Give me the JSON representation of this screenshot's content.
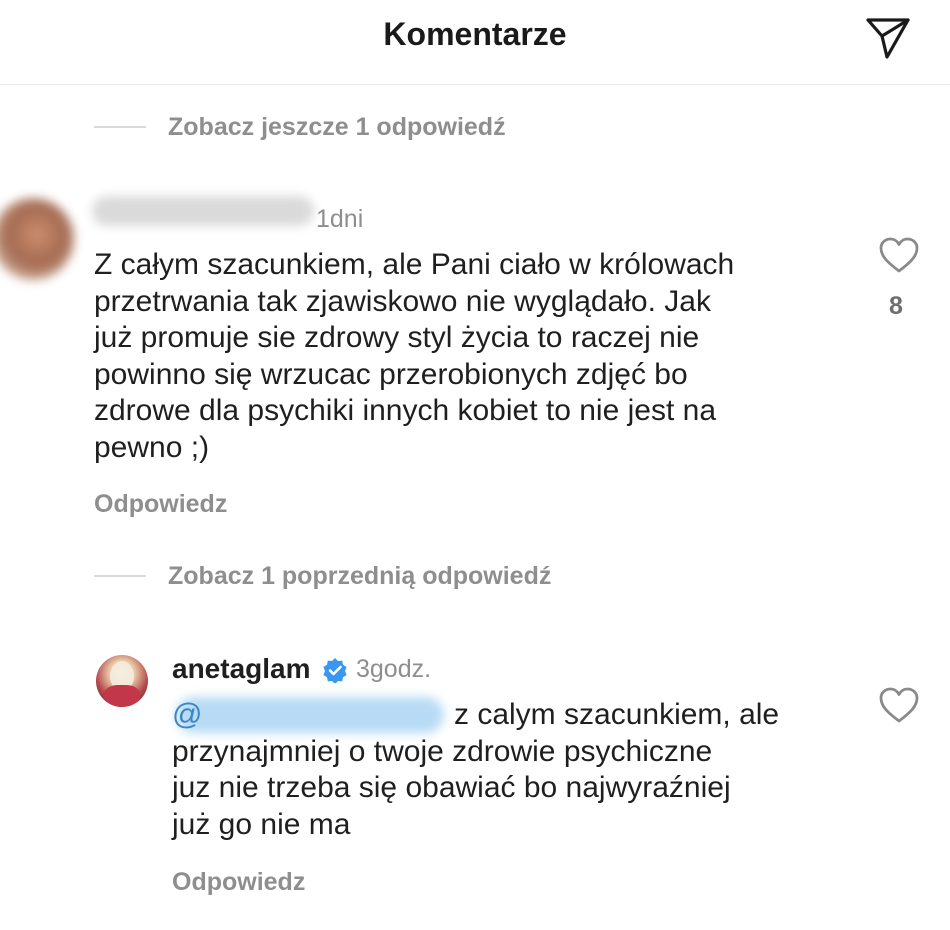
{
  "header": {
    "title": "Komentarze",
    "send_icon": "paper-plane-icon"
  },
  "threads": {
    "view_more_top": "Zobacz jeszcze 1 odpowiedź",
    "view_previous": "Zobacz 1 poprzednią odpowiedź"
  },
  "comment1": {
    "time": "1dni",
    "text_lines": [
      "Z całym szacunkiem, ale Pani ciało w królowach",
      "przetrwania tak zjawiskowo nie wyglądało. Jak",
      "już promuje sie zdrowy styl życia to raczej nie",
      "powinno się wrzucac przerobionych zdjęć bo",
      "zdrowe dla psychiki innych kobiet to nie jest na",
      "pewno ;)"
    ],
    "reply_label": "Odpowiedz",
    "like_count": "8"
  },
  "comment2": {
    "username": "anetaglam",
    "time": "3godz.",
    "mention_prefix": "@",
    "text_first_line_rest": "z calym szacunkiem, ale",
    "text_lines": [
      "przynajmniej o twoje zdrowie psychiczne",
      "juz nie trzeba się obawiać bo najwyraźniej",
      "już go nie ma"
    ],
    "reply_label": "Odpowiedz"
  },
  "colors": {
    "muted": "#8e8e8e",
    "text": "#1f1f1f",
    "verified": "#3897f0",
    "divider": "#d9d9d9"
  }
}
